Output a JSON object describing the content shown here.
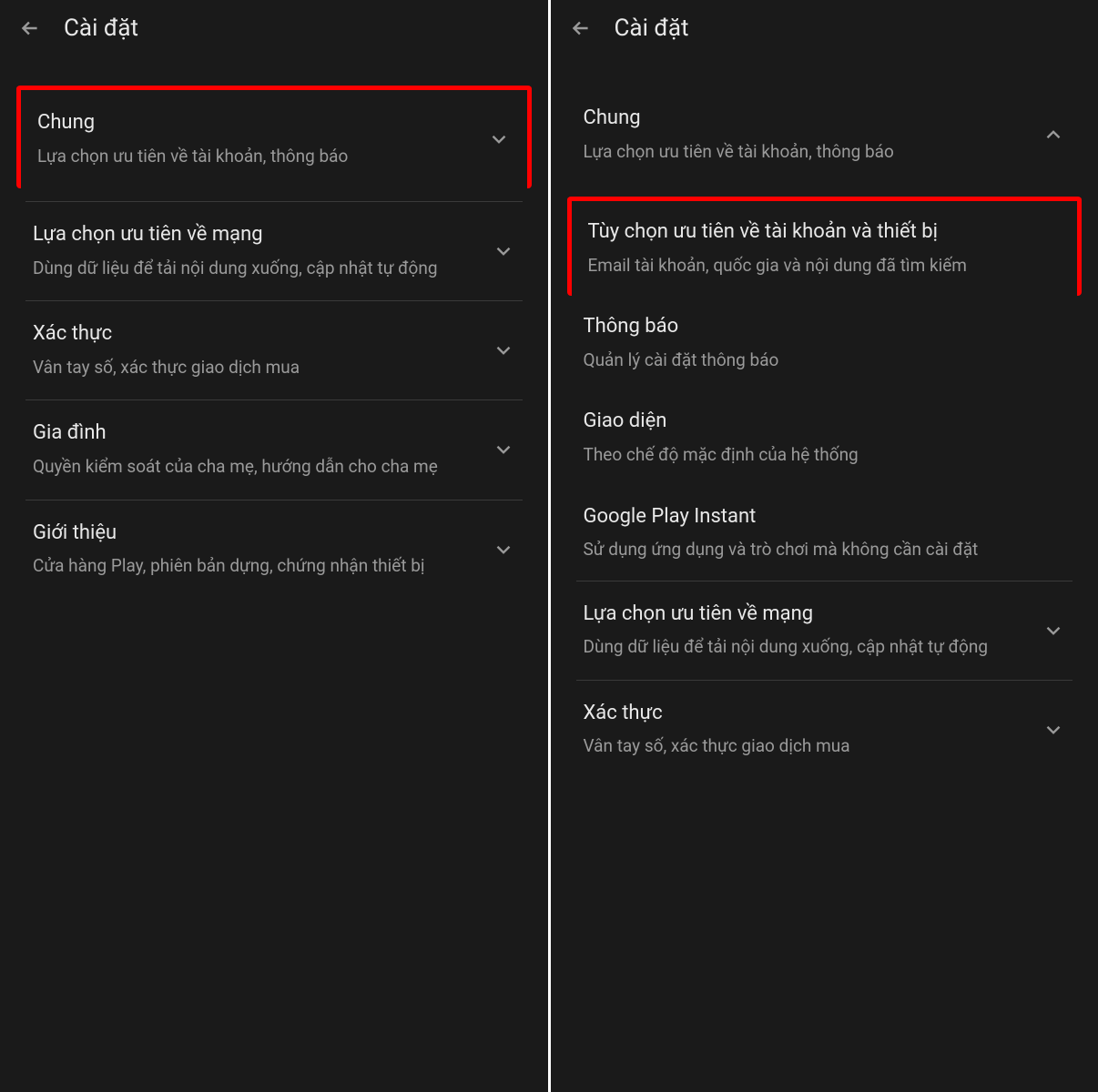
{
  "left": {
    "header": {
      "title": "Cài đặt"
    },
    "items": [
      {
        "title": "Chung",
        "subtitle": "Lựa chọn ưu tiên về tài khoản, thông báo",
        "chevron": "down",
        "highlighted": true
      },
      {
        "title": "Lựa chọn ưu tiên về mạng",
        "subtitle": "Dùng dữ liệu để tải nội dung xuống, cập nhật tự động",
        "chevron": "down"
      },
      {
        "title": "Xác thực",
        "subtitle": "Vân tay số, xác thực giao dịch mua",
        "chevron": "down"
      },
      {
        "title": "Gia đình",
        "subtitle": "Quyền kiểm soát của cha mẹ, hướng dẫn cho cha mẹ",
        "chevron": "down"
      },
      {
        "title": "Giới thiệu",
        "subtitle": "Cửa hàng Play, phiên bản dựng, chứng nhận thiết bị",
        "chevron": "down"
      }
    ]
  },
  "right": {
    "header": {
      "title": "Cài đặt"
    },
    "items": [
      {
        "title": "Chung",
        "subtitle": "Lựa chọn ưu tiên về tài khoản, thông báo",
        "chevron": "up"
      },
      {
        "title": "Tùy chọn ưu tiên về tài khoản và thiết bị",
        "subtitle": "Email tài khoản, quốc gia và nội dung đã tìm kiếm",
        "highlighted": true
      },
      {
        "title": "Thông báo",
        "subtitle": "Quản lý cài đặt thông báo"
      },
      {
        "title": "Giao diện",
        "subtitle": "Theo chế độ mặc định của hệ thống"
      },
      {
        "title": "Google Play Instant",
        "subtitle": "Sử dụng ứng dụng và trò chơi mà không cần cài đặt"
      },
      {
        "title": "Lựa chọn ưu tiên về mạng",
        "subtitle": "Dùng dữ liệu để tải nội dung xuống, cập nhật tự động",
        "chevron": "down"
      },
      {
        "title": "Xác thực",
        "subtitle": "Vân tay số, xác thực giao dịch mua",
        "chevron": "down"
      }
    ]
  }
}
